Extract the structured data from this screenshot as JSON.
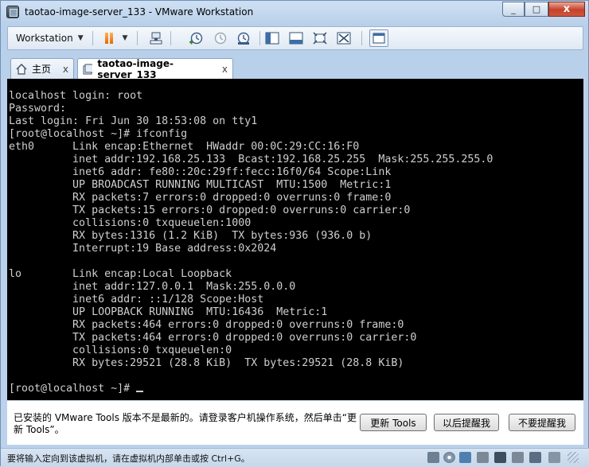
{
  "window": {
    "title": "taotao-image-server_133 - VMware Workstation"
  },
  "titlebar": {
    "minimize_glyph": "_",
    "maximize_glyph": "□",
    "close_glyph": "x"
  },
  "toolbar": {
    "menu_label": "Workstation",
    "menu_caret": "▼",
    "power_caret": "▼"
  },
  "tabs": [
    {
      "label": "主页",
      "close_glyph": "x"
    },
    {
      "label": "taotao-image-server_133",
      "close_glyph": "x"
    }
  ],
  "console": {
    "lines": [
      "localhost login: root",
      "Password:",
      "Last login: Fri Jun 30 18:53:08 on tty1",
      "[root@localhost ~]# ifconfig",
      "eth0      Link encap:Ethernet  HWaddr 00:0C:29:CC:16:F0",
      "          inet addr:192.168.25.133  Bcast:192.168.25.255  Mask:255.255.255.0",
      "          inet6 addr: fe80::20c:29ff:fecc:16f0/64 Scope:Link",
      "          UP BROADCAST RUNNING MULTICAST  MTU:1500  Metric:1",
      "          RX packets:7 errors:0 dropped:0 overruns:0 frame:0",
      "          TX packets:15 errors:0 dropped:0 overruns:0 carrier:0",
      "          collisions:0 txqueuelen:1000",
      "          RX bytes:1316 (1.2 KiB)  TX bytes:936 (936.0 b)",
      "          Interrupt:19 Base address:0x2024",
      "",
      "lo        Link encap:Local Loopback",
      "          inet addr:127.0.0.1  Mask:255.0.0.0",
      "          inet6 addr: ::1/128 Scope:Host",
      "          UP LOOPBACK RUNNING  MTU:16436  Metric:1",
      "          RX packets:464 errors:0 dropped:0 overruns:0 frame:0",
      "          TX packets:464 errors:0 dropped:0 overruns:0 carrier:0",
      "          collisions:0 txqueuelen:0",
      "          RX bytes:29521 (28.8 KiB)  TX bytes:29521 (28.8 KiB)",
      ""
    ],
    "prompt": "[root@localhost ~]# "
  },
  "notice": {
    "message": "已安装的 VMware Tools 版本不是最新的。请登录客户机操作系统，然后单击“更新 Tools”。",
    "buttons": {
      "update": "更新 Tools",
      "remind_later": "以后提醒我",
      "never_remind": "不要提醒我"
    }
  },
  "status": {
    "text": "要将输入定向到该虚拟机，请在虚拟机内部单击或按 Ctrl+G。"
  },
  "colors": {
    "console_bg": "#000000",
    "console_fg": "#cfcfcf",
    "chrome_blue": "#c9dcf0"
  }
}
